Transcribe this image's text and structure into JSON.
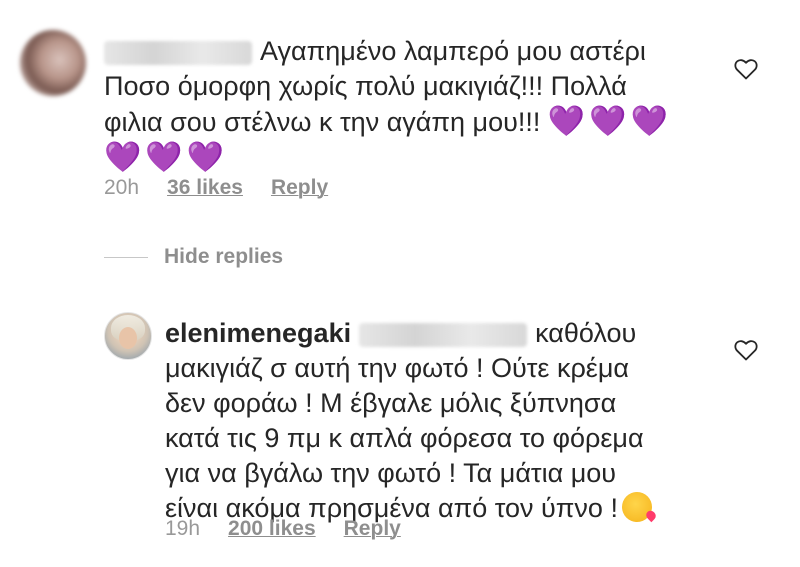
{
  "comments": [
    {
      "username_redacted": true,
      "text_lines": [
        "Αγαπημένο λαμπερό μου αστέρι",
        "Ποσο όμορφη χωρίς πολύ μακιγιάζ!!! Πολλά",
        "φιλια σου στέλνω κ την αγάπη μου!!!"
      ],
      "hearts_line1": "💜💜💜",
      "hearts_line2": "💜💜💜",
      "time": "20h",
      "likes": "36 likes",
      "reply": "Reply"
    },
    {
      "username": "elenimenegaki",
      "text_first": "καθόλου",
      "text_lines": [
        "μακιγιάζ σ αυτή την φωτό ! Ούτε κρέμα",
        "δεν φοράω ! Μ έβγαλε μόλις ξύπνησα",
        "κατά τις 9 πμ κ απλά φόρεσα το φόρεμα",
        "για να βγάλω την φωτό ! Τα μάτια μου",
        "είναι ακόμα πρησμένα από τον ύπνο !"
      ],
      "time": "19h",
      "likes": "200 likes",
      "reply": "Reply"
    }
  ],
  "replies_toggle": "Hide replies",
  "colors": {
    "text": "#262626",
    "meta": "#8e8e8e",
    "heart_emoji": "#a24ae6"
  },
  "icons": [
    "like-heart-icon",
    "kiss-emoji-icon",
    "purple-heart-emoji"
  ]
}
